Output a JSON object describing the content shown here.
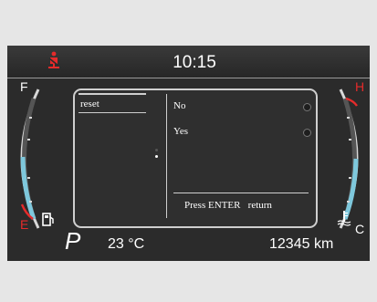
{
  "clock": "10:15",
  "gauges": {
    "fuel": {
      "full_label": "F",
      "empty_label": "E"
    },
    "coolant": {
      "hot_label": "H",
      "cold_label": "C"
    }
  },
  "menu": {
    "left_item": "reset",
    "options": [
      {
        "label": "No"
      },
      {
        "label": "Yes"
      }
    ],
    "hint_action": "Press ENTER",
    "hint_return": "return"
  },
  "status": {
    "gear": "P",
    "outside_temp": "23 °C",
    "odometer": "12345 km"
  },
  "colors": {
    "warning_red": "#e52b2b",
    "gauge_blue": "#7ec8dc",
    "dash_bg": "#2b2b2b"
  }
}
